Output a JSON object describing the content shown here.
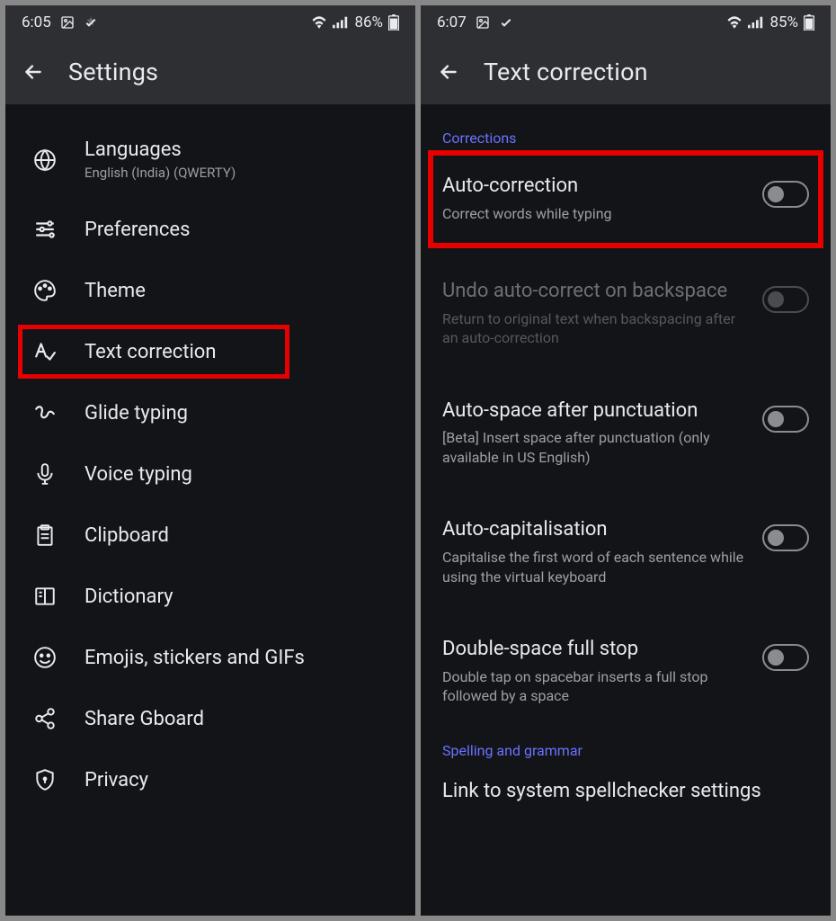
{
  "left": {
    "status": {
      "time": "6:05",
      "battery": "86%"
    },
    "title": "Settings",
    "items": [
      {
        "title": "Languages",
        "subtitle": "English (India) (QWERTY)"
      },
      {
        "title": "Preferences"
      },
      {
        "title": "Theme"
      },
      {
        "title": "Text correction",
        "highlight": true
      },
      {
        "title": "Glide typing"
      },
      {
        "title": "Voice typing"
      },
      {
        "title": "Clipboard"
      },
      {
        "title": "Dictionary"
      },
      {
        "title": "Emojis, stickers and GIFs"
      },
      {
        "title": "Share Gboard"
      },
      {
        "title": "Privacy"
      }
    ]
  },
  "right": {
    "status": {
      "time": "6:07",
      "battery": "85%"
    },
    "title": "Text correction",
    "section1": "Corrections",
    "items": [
      {
        "title": "Auto-correction",
        "subtitle": "Correct words while typing",
        "highlight": true
      },
      {
        "title": "Undo auto-correct on backspace",
        "subtitle": "Return to original text when backspacing after an auto-correction",
        "disabled": true
      },
      {
        "title": "Auto-space after punctuation",
        "subtitle": "[Beta] Insert space after punctuation (only available in US English)"
      },
      {
        "title": "Auto-capitalisation",
        "subtitle": "Capitalise the first word of each sentence while using the virtual keyboard"
      },
      {
        "title": "Double-space full stop",
        "subtitle": "Double tap on spacebar inserts a full stop followed by a space"
      }
    ],
    "section2": "Spelling and grammar",
    "linkItem": {
      "title": "Link to system spellchecker settings"
    }
  }
}
